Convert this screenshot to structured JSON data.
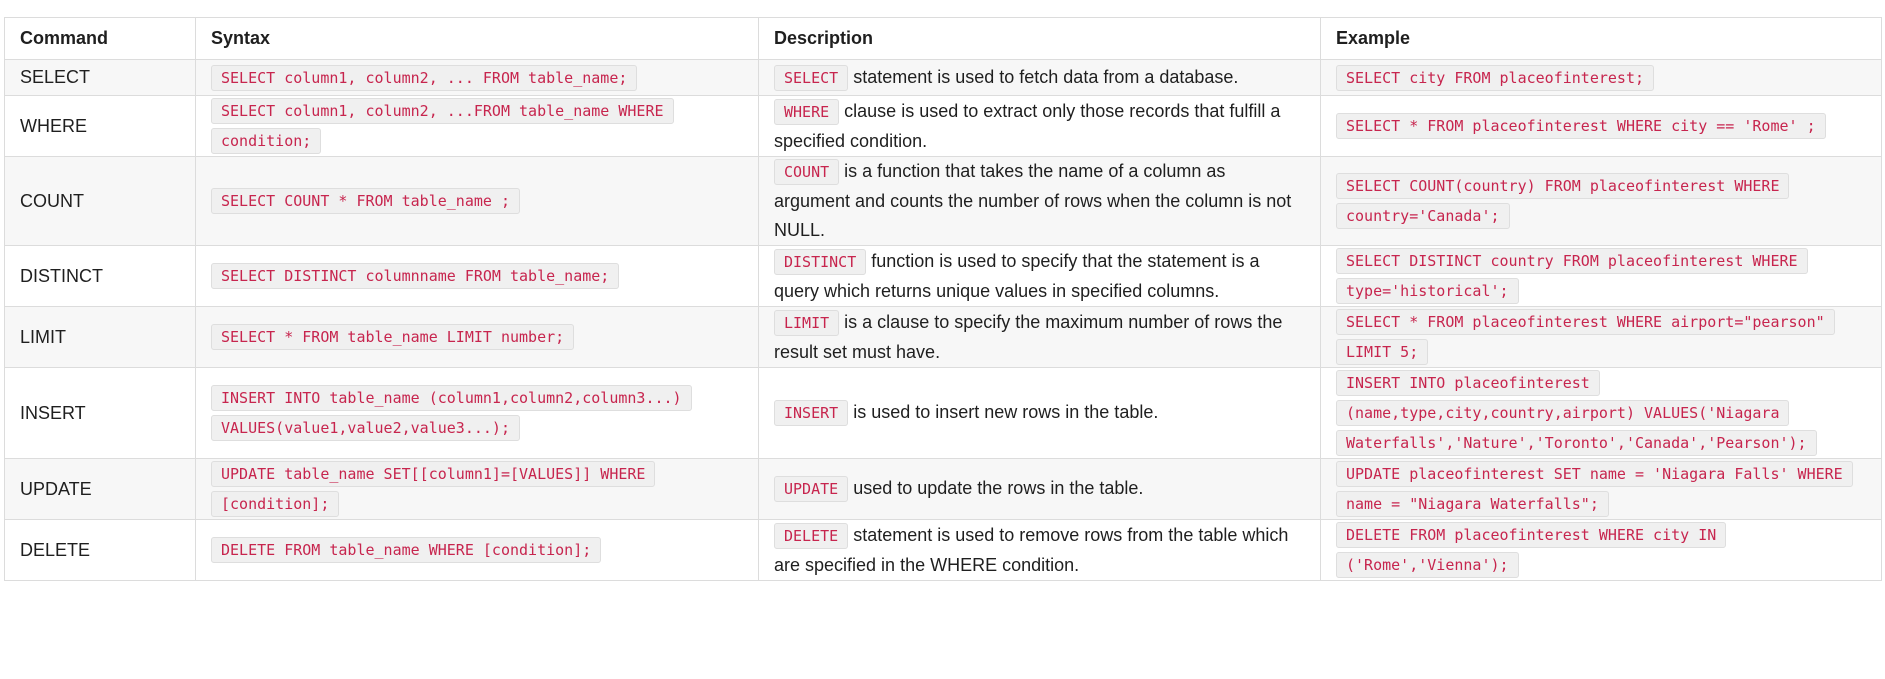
{
  "table": {
    "headers": [
      "Command",
      "Syntax",
      "Description",
      "Example"
    ],
    "rows": [
      {
        "command": "SELECT",
        "syntax": "SELECT column1, column2, ... FROM table_name;",
        "desc_code": "SELECT",
        "desc_text": " statement is used to fetch data from a database.",
        "example": "SELECT city FROM placeofinterest;"
      },
      {
        "command": "WHERE",
        "syntax": "SELECT column1, column2, ...FROM table_name WHERE condition;",
        "desc_code": "WHERE",
        "desc_text": " clause is used to extract only those records that fulfill a specified condition.",
        "example": "SELECT * FROM placeofinterest WHERE city == 'Rome' ;"
      },
      {
        "command": "COUNT",
        "syntax": "SELECT COUNT * FROM table_name ;",
        "desc_code": "COUNT",
        "desc_text": " is a function that takes the name of a column as argument and counts the number of rows when the column is not NULL.",
        "example": "SELECT COUNT(country) FROM placeofinterest WHERE country='Canada';"
      },
      {
        "command": "DISTINCT",
        "syntax": "SELECT DISTINCT columnname FROM table_name;",
        "desc_code": "DISTINCT",
        "desc_text": " function is used to specify that the statement is a query which returns unique values in specified columns.",
        "example": "SELECT DISTINCT country FROM placeofinterest WHERE type='historical';"
      },
      {
        "command": "LIMIT",
        "syntax": "SELECT * FROM table_name LIMIT number;",
        "desc_code": "LIMIT",
        "desc_text": " is a clause to specify the maximum number of rows the result set must have.",
        "example": "SELECT * FROM placeofinterest WHERE airport=\"pearson\" LIMIT 5;"
      },
      {
        "command": "INSERT",
        "syntax": "INSERT INTO table_name (column1,column2,column3...) VALUES(value1,value2,value3...);",
        "desc_code": "INSERT",
        "desc_text": " is used to insert new rows in the table.",
        "example": "INSERT INTO placeofinterest (name,type,city,country,airport) VALUES('Niagara Waterfalls','Nature','Toronto','Canada','Pearson');"
      },
      {
        "command": "UPDATE",
        "syntax": "UPDATE table_name SET[[column1]=[VALUES]] WHERE [condition];",
        "desc_code": "UPDATE",
        "desc_text": " used to update the rows in the table.",
        "example": "UPDATE placeofinterest SET name = 'Niagara Falls' WHERE name = \"Niagara Waterfalls\";"
      },
      {
        "command": "DELETE",
        "syntax": "DELETE FROM table_name WHERE [condition];",
        "desc_code": "DELETE",
        "desc_text": " statement is used to remove rows from the table which are specified in the WHERE condition.",
        "example": "DELETE FROM placeofinterest WHERE city IN ('Rome','Vienna');"
      }
    ]
  },
  "colors": {
    "code_text": "#c7254e",
    "code_bg": "#f0f0f0",
    "border": "#dcdcdc",
    "stripe": "#f7f7f7"
  }
}
